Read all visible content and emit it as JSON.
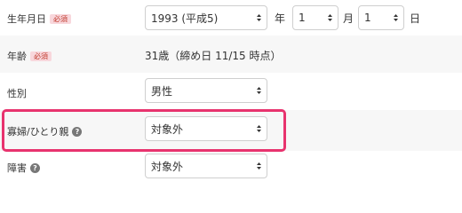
{
  "birthdate": {
    "label": "生年月日",
    "required_badge": "必須",
    "year_value": "1993 (平成5)",
    "year_unit": "年",
    "month_value": "1",
    "month_unit": "月",
    "day_value": "1",
    "day_unit": "日"
  },
  "age": {
    "label": "年齢",
    "required_badge": "必須",
    "value": "31歳（締め日 11/15 時点）"
  },
  "gender": {
    "label": "性別",
    "value": "男性"
  },
  "single_parent": {
    "label": "寡婦/ひとり親",
    "help_icon": "?",
    "value": "対象外"
  },
  "disability": {
    "label": "障害",
    "help_icon": "?",
    "value": "対象外"
  },
  "colors": {
    "highlight_border": "#e8336e",
    "required_badge_bg": "#f8d7dc",
    "required_badge_text": "#c0392b"
  }
}
